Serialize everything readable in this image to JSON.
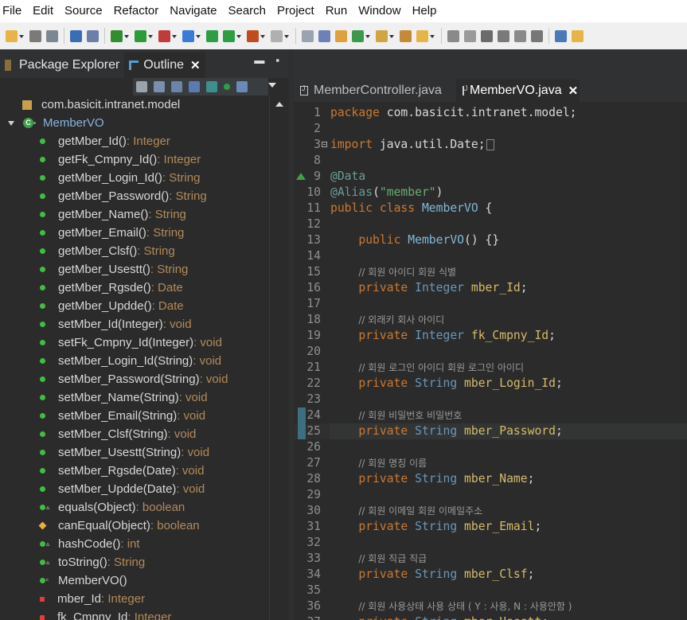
{
  "menu": [
    "File",
    "Edit",
    "Source",
    "Refactor",
    "Navigate",
    "Search",
    "Project",
    "Run",
    "Window",
    "Help"
  ],
  "left_panel": {
    "tabs": [
      {
        "label": "Package Explorer",
        "active": false
      },
      {
        "label": "Outline",
        "active": true
      }
    ],
    "tree": {
      "package": "com.basicit.intranet.model",
      "class": "MemberVO",
      "members": [
        {
          "name": "getMber_Id()",
          "type": " : Integer",
          "kind": "public"
        },
        {
          "name": "getFk_Cmpny_Id()",
          "type": " : Integer",
          "kind": "public"
        },
        {
          "name": "getMber_Login_Id()",
          "type": " : String",
          "kind": "public"
        },
        {
          "name": "getMber_Password()",
          "type": " : String",
          "kind": "public"
        },
        {
          "name": "getMber_Name()",
          "type": " : String",
          "kind": "public"
        },
        {
          "name": "getMber_Email()",
          "type": " : String",
          "kind": "public"
        },
        {
          "name": "getMber_Clsf()",
          "type": " : String",
          "kind": "public"
        },
        {
          "name": "getMber_Usestt()",
          "type": " : String",
          "kind": "public"
        },
        {
          "name": "getMber_Rgsde()",
          "type": " : Date",
          "kind": "public"
        },
        {
          "name": "getMber_Updde()",
          "type": " : Date",
          "kind": "public"
        },
        {
          "name": "setMber_Id(Integer)",
          "type": " : void",
          "kind": "public"
        },
        {
          "name": "setFk_Cmpny_Id(Integer)",
          "type": " : void",
          "kind": "public"
        },
        {
          "name": "setMber_Login_Id(String)",
          "type": " : void",
          "kind": "public"
        },
        {
          "name": "setMber_Password(String)",
          "type": " : void",
          "kind": "public"
        },
        {
          "name": "setMber_Name(String)",
          "type": " : void",
          "kind": "public"
        },
        {
          "name": "setMber_Email(String)",
          "type": " : void",
          "kind": "public"
        },
        {
          "name": "setMber_Clsf(String)",
          "type": " : void",
          "kind": "public"
        },
        {
          "name": "setMber_Usestt(String)",
          "type": " : void",
          "kind": "public"
        },
        {
          "name": "setMber_Rgsde(Date)",
          "type": " : void",
          "kind": "public"
        },
        {
          "name": "setMber_Updde(Date)",
          "type": " : void",
          "kind": "public"
        },
        {
          "name": "equals(Object)",
          "type": " : boolean",
          "kind": "override"
        },
        {
          "name": "canEqual(Object)",
          "type": " : boolean",
          "kind": "protected"
        },
        {
          "name": "hashCode()",
          "type": " : int",
          "kind": "override"
        },
        {
          "name": "toString()",
          "type": " : String",
          "kind": "override"
        },
        {
          "name": "MemberVO()",
          "type": "",
          "kind": "constructor"
        },
        {
          "name": "mber_Id",
          "type": " : Integer",
          "kind": "private-field"
        },
        {
          "name": "fk_Cmpny_Id",
          "type": " : Integer",
          "kind": "private-field"
        }
      ]
    }
  },
  "editor": {
    "tabs": [
      {
        "label": "MemberController.java",
        "active": false
      },
      {
        "label": "MemberVO.java",
        "active": true
      }
    ],
    "lines": [
      {
        "n": "1",
        "tokens": [
          [
            "kw",
            "package"
          ],
          [
            "pl",
            " com.basicit.intranet.model;"
          ]
        ]
      },
      {
        "n": "2",
        "tokens": []
      },
      {
        "n": "3",
        "tokens": [
          [
            "kw",
            "import"
          ],
          [
            "pl",
            " java.util.Date;"
          ]
        ],
        "fold": true,
        "collapsed": true
      },
      {
        "n": "8",
        "tokens": []
      },
      {
        "n": "9",
        "tokens": [
          [
            "ann",
            "@Data"
          ]
        ],
        "override": true
      },
      {
        "n": "10",
        "tokens": [
          [
            "ann",
            "@Alias"
          ],
          [
            "pl",
            "("
          ],
          [
            "str",
            "\"member\""
          ],
          [
            "pl",
            ")"
          ]
        ]
      },
      {
        "n": "11",
        "tokens": [
          [
            "kw",
            "public class "
          ],
          [
            "cls",
            "MemberVO"
          ],
          [
            "pl",
            " {"
          ]
        ]
      },
      {
        "n": "12",
        "tokens": []
      },
      {
        "n": "13",
        "tokens": [
          [
            "pl",
            "    "
          ],
          [
            "kw",
            "public "
          ],
          [
            "cls",
            "MemberVO"
          ],
          [
            "pl",
            "() {}"
          ]
        ]
      },
      {
        "n": "14",
        "tokens": []
      },
      {
        "n": "15",
        "tokens": [
          [
            "pl",
            "    "
          ],
          [
            "cm",
            "// 회원 아이디 회원 식별"
          ]
        ]
      },
      {
        "n": "16",
        "tokens": [
          [
            "pl",
            "    "
          ],
          [
            "kw",
            "private "
          ],
          [
            "ty",
            "Integer"
          ],
          [
            "pl",
            " "
          ],
          [
            "fld",
            "mber_Id"
          ],
          [
            "pl",
            ";"
          ]
        ]
      },
      {
        "n": "17",
        "tokens": []
      },
      {
        "n": "18",
        "tokens": [
          [
            "pl",
            "    "
          ],
          [
            "cm",
            "// 외래키 회사 아이디"
          ]
        ]
      },
      {
        "n": "19",
        "tokens": [
          [
            "pl",
            "    "
          ],
          [
            "kw",
            "private "
          ],
          [
            "ty",
            "Integer"
          ],
          [
            "pl",
            " "
          ],
          [
            "fld",
            "fk_Cmpny_Id"
          ],
          [
            "pl",
            ";"
          ]
        ]
      },
      {
        "n": "20",
        "tokens": []
      },
      {
        "n": "21",
        "tokens": [
          [
            "pl",
            "    "
          ],
          [
            "cm",
            "// 회원 로그인 아이디 회원 로그인 아이디"
          ]
        ]
      },
      {
        "n": "22",
        "tokens": [
          [
            "pl",
            "    "
          ],
          [
            "kw",
            "private "
          ],
          [
            "ty",
            "String"
          ],
          [
            "pl",
            " "
          ],
          [
            "fld",
            "mber_Login_Id"
          ],
          [
            "pl",
            ";"
          ]
        ]
      },
      {
        "n": "23",
        "tokens": []
      },
      {
        "n": "24",
        "tokens": [
          [
            "pl",
            "    "
          ],
          [
            "cm",
            "// 회원 비밀번호 비밀번호"
          ]
        ],
        "changed": true
      },
      {
        "n": "25",
        "tokens": [
          [
            "pl",
            "    "
          ],
          [
            "kw",
            "private "
          ],
          [
            "ty",
            "String"
          ],
          [
            "pl",
            " "
          ],
          [
            "fld",
            "mber_Password"
          ],
          [
            "pl",
            ";"
          ]
        ],
        "current": true,
        "changed": true
      },
      {
        "n": "26",
        "tokens": []
      },
      {
        "n": "27",
        "tokens": [
          [
            "pl",
            "    "
          ],
          [
            "cm",
            "// 회원 명칭 이름"
          ]
        ]
      },
      {
        "n": "28",
        "tokens": [
          [
            "pl",
            "    "
          ],
          [
            "kw",
            "private "
          ],
          [
            "ty",
            "String"
          ],
          [
            "pl",
            " "
          ],
          [
            "fld",
            "mber_Name"
          ],
          [
            "pl",
            ";"
          ]
        ]
      },
      {
        "n": "29",
        "tokens": []
      },
      {
        "n": "30",
        "tokens": [
          [
            "pl",
            "    "
          ],
          [
            "cm",
            "// 회원 이메일 회원 이메일주소"
          ]
        ]
      },
      {
        "n": "31",
        "tokens": [
          [
            "pl",
            "    "
          ],
          [
            "kw",
            "private "
          ],
          [
            "ty",
            "String"
          ],
          [
            "pl",
            " "
          ],
          [
            "fld",
            "mber_Email"
          ],
          [
            "pl",
            ";"
          ]
        ]
      },
      {
        "n": "32",
        "tokens": []
      },
      {
        "n": "33",
        "tokens": [
          [
            "pl",
            "    "
          ],
          [
            "cm",
            "// 회원 직급 직급"
          ]
        ]
      },
      {
        "n": "34",
        "tokens": [
          [
            "pl",
            "    "
          ],
          [
            "kw",
            "private "
          ],
          [
            "ty",
            "String"
          ],
          [
            "pl",
            " "
          ],
          [
            "fld",
            "mber_Clsf"
          ],
          [
            "pl",
            ";"
          ]
        ]
      },
      {
        "n": "35",
        "tokens": []
      },
      {
        "n": "36",
        "tokens": [
          [
            "pl",
            "    "
          ],
          [
            "cm",
            "// 회원 사용상태 사용 상태 ( Y : 사용, N : 사용안함 )"
          ]
        ]
      },
      {
        "n": "37",
        "tokens": [
          [
            "pl",
            "    "
          ],
          [
            "kw",
            "private "
          ],
          [
            "ty",
            "String"
          ],
          [
            "pl",
            " "
          ],
          [
            "fld",
            "mber_Usestt"
          ],
          [
            "pl",
            ";"
          ]
        ]
      }
    ]
  },
  "colors": {
    "keyword": "#cc7832",
    "type": "#6897bb",
    "annotation": "#6a9b94",
    "string": "#6aab73",
    "field": "#d6ba6b",
    "comment": "#9a9a9a",
    "method_green": "#3fbf3f"
  }
}
